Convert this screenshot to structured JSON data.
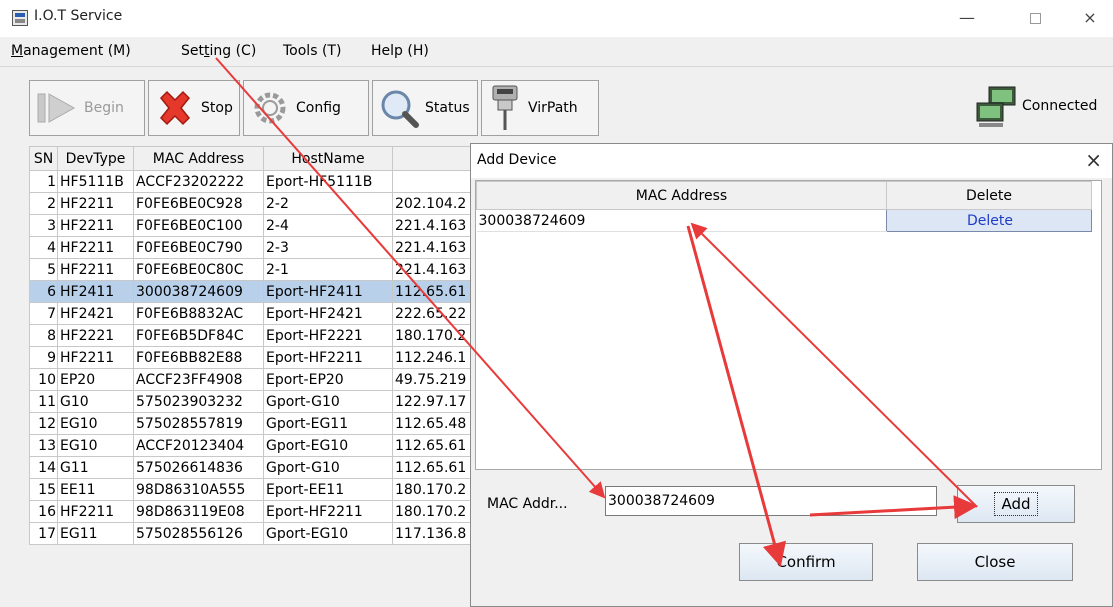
{
  "window": {
    "title": "I.O.T Service",
    "minimize": "—",
    "close": "×"
  },
  "menu": {
    "management": {
      "pre": "",
      "key": "M",
      "post": "anagement (M)"
    },
    "setting": {
      "pre": "Set",
      "key": "t",
      "post": "ing (C)"
    },
    "tools": "Tools (T)",
    "help": "Help (H)"
  },
  "toolbar": {
    "begin": "Begin",
    "stop": "Stop",
    "config": "Config",
    "status": "Status",
    "virpath": "VirPath",
    "connected": "Connected"
  },
  "table": {
    "headers": [
      "SN",
      "DevType",
      "MAC Address",
      "HostName",
      "I"
    ],
    "rows": [
      {
        "sn": "1",
        "type": "HF5111B",
        "mac": "ACCF23202222",
        "host": "Eport-HF5111B",
        "ip": ""
      },
      {
        "sn": "2",
        "type": "HF2211",
        "mac": "F0FE6BE0C928",
        "host": "2-2",
        "ip": "202.104.2"
      },
      {
        "sn": "3",
        "type": "HF2211",
        "mac": "F0FE6BE0C100",
        "host": "2-4",
        "ip": "221.4.163"
      },
      {
        "sn": "4",
        "type": "HF2211",
        "mac": "F0FE6BE0C790",
        "host": "2-3",
        "ip": "221.4.163"
      },
      {
        "sn": "5",
        "type": "HF2211",
        "mac": "F0FE6BE0C80C",
        "host": "2-1",
        "ip": "221.4.163"
      },
      {
        "sn": "6",
        "type": "HF2411",
        "mac": "300038724609",
        "host": "Eport-HF2411",
        "ip": "112.65.61"
      },
      {
        "sn": "7",
        "type": "HF2421",
        "mac": "F0FE6B8832AC",
        "host": "Eport-HF2421",
        "ip": "222.65.22"
      },
      {
        "sn": "8",
        "type": "HF2221",
        "mac": "F0FE6B5DF84C",
        "host": "Eport-HF2221",
        "ip": "180.170.2"
      },
      {
        "sn": "9",
        "type": "HF2211",
        "mac": "F0FE6BB82E88",
        "host": "Eport-HF2211",
        "ip": "112.246.1"
      },
      {
        "sn": "10",
        "type": "EP20",
        "mac": "ACCF23FF4908",
        "host": "Eport-EP20",
        "ip": "49.75.219"
      },
      {
        "sn": "11",
        "type": "G10",
        "mac": "575023903232",
        "host": "Gport-G10",
        "ip": "122.97.17"
      },
      {
        "sn": "12",
        "type": "EG10",
        "mac": "575028557819",
        "host": "Gport-EG11",
        "ip": "112.65.48"
      },
      {
        "sn": "13",
        "type": "EG10",
        "mac": "ACCF20123404",
        "host": "Gport-EG10",
        "ip": "112.65.61"
      },
      {
        "sn": "14",
        "type": "G11",
        "mac": "575026614836",
        "host": "Gport-G10",
        "ip": "112.65.61"
      },
      {
        "sn": "15",
        "type": "EE11",
        "mac": "98D86310A555",
        "host": "Eport-EE11",
        "ip": "180.170.2"
      },
      {
        "sn": "16",
        "type": "HF2211",
        "mac": "98D863119E08",
        "host": "Eport-HF2211",
        "ip": "180.170.2"
      },
      {
        "sn": "17",
        "type": "EG11",
        "mac": "575028556126",
        "host": "Gport-EG10",
        "ip": "117.136.8"
      }
    ]
  },
  "dialog": {
    "title": "Add Device",
    "close": "×",
    "col_mac": "MAC Address",
    "col_delete": "Delete",
    "entries": [
      {
        "mac": "300038724609",
        "delete": "Delete"
      }
    ],
    "mac_label": "MAC Addr...",
    "mac_value": "300038724609",
    "add": "Add",
    "confirm": "Confirm",
    "close_button": "Close"
  },
  "colors": {
    "selected_row": "#b8d0ea",
    "annotation_arrow": "#e83a3a",
    "delete_link": "#1f3cc7"
  }
}
